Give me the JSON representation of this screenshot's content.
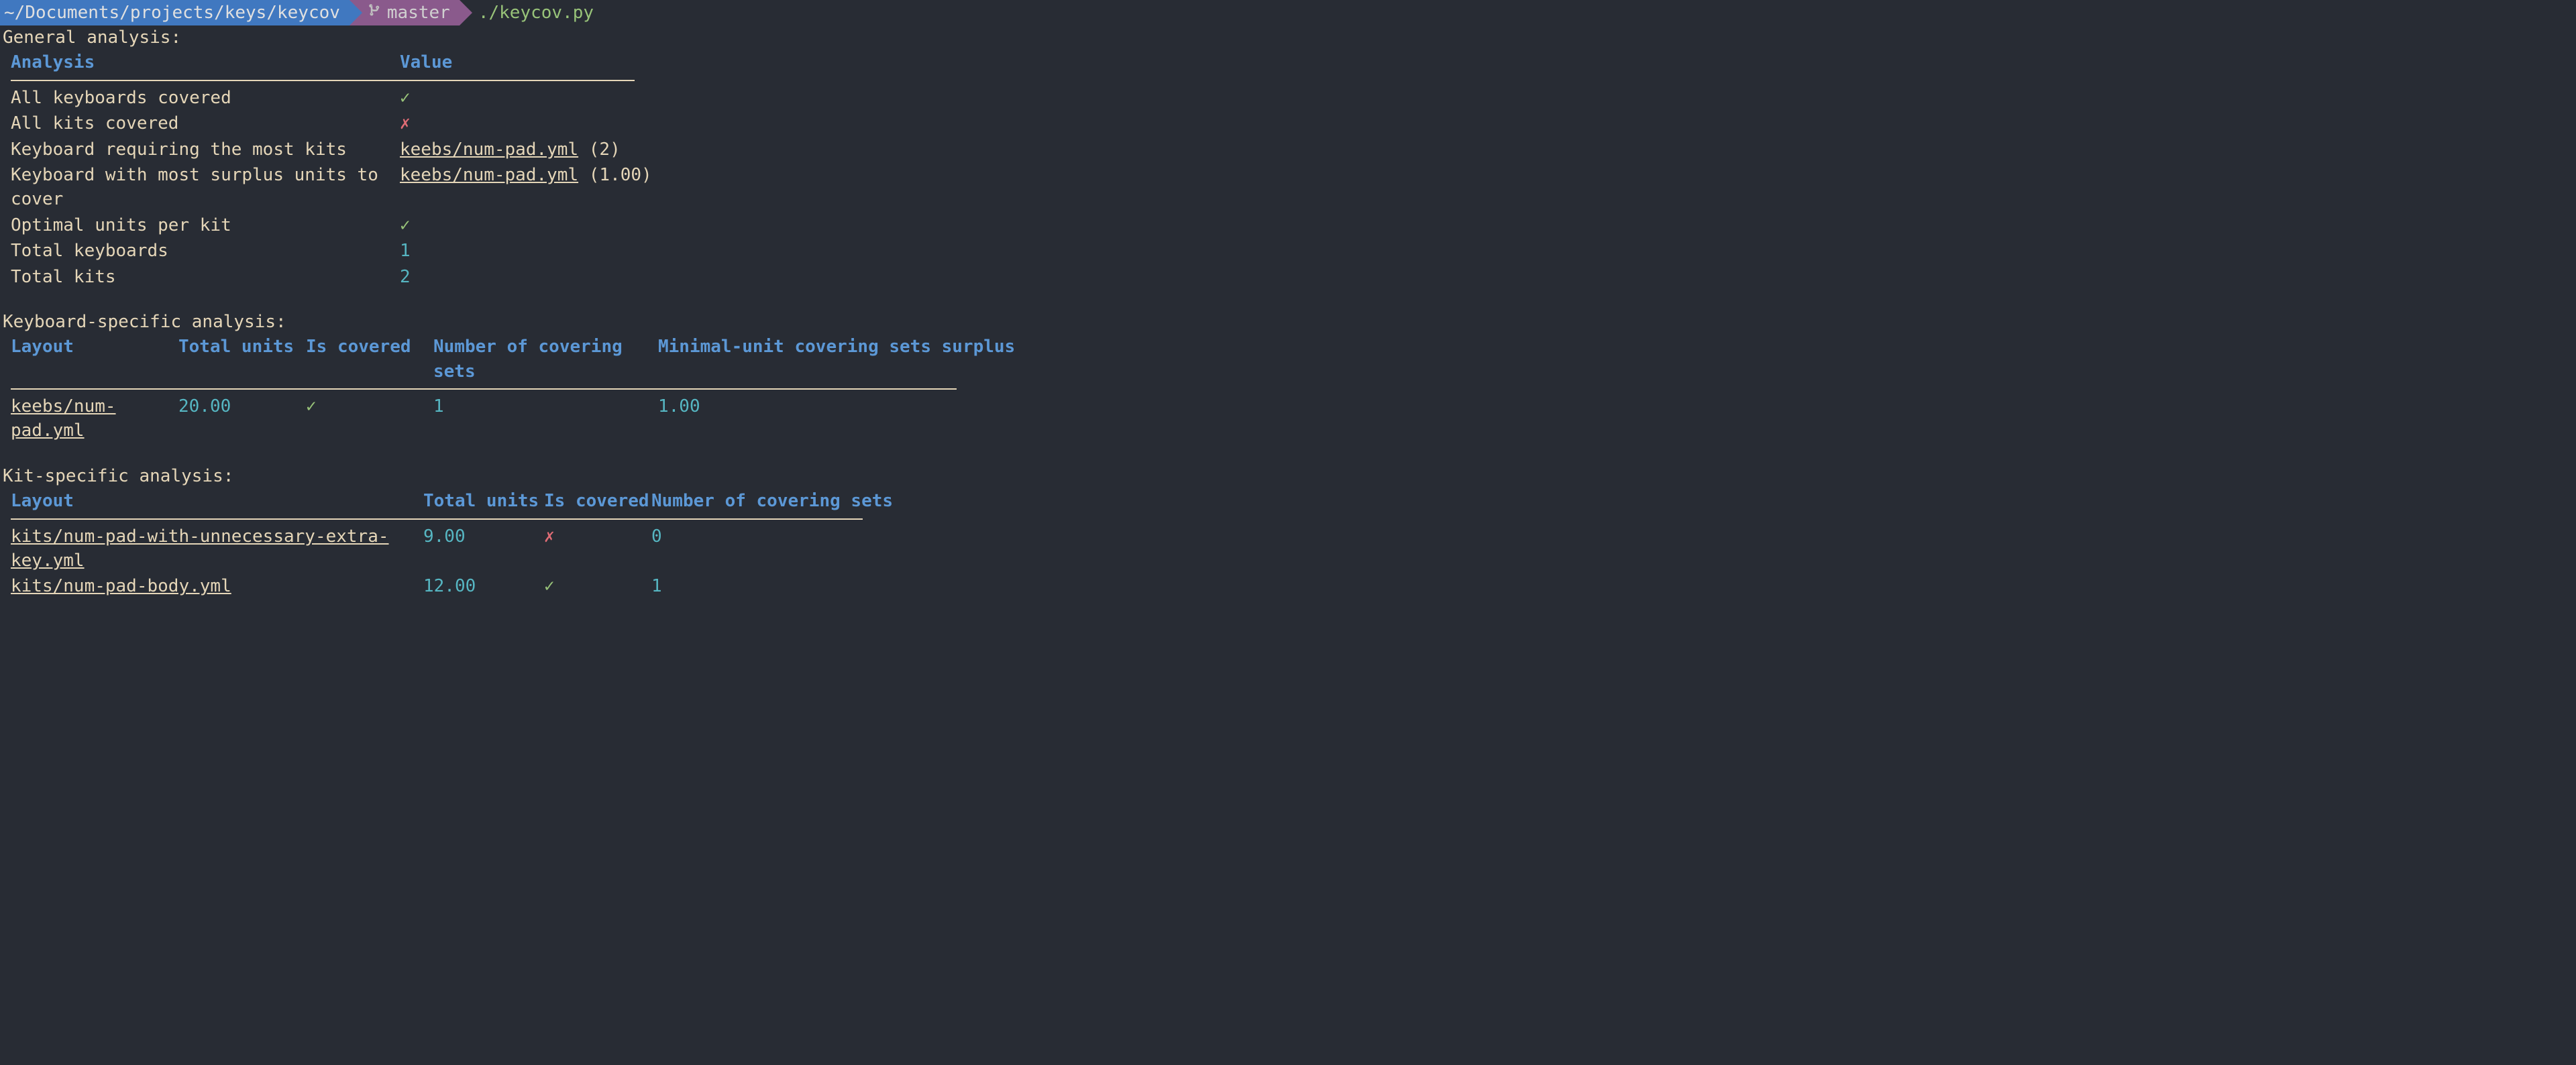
{
  "prompt": {
    "path": "~/Documents/projects/keys/keycov",
    "branch": "master",
    "command": "./keycov.py"
  },
  "general": {
    "title": "General analysis:",
    "header_analysis": "Analysis",
    "header_value": "Value",
    "rows": [
      {
        "label": "All keyboards covered",
        "value": "✓",
        "class": "value-green"
      },
      {
        "label": "All kits covered",
        "value": "✗",
        "class": "value-red"
      },
      {
        "label": "Keyboard requiring the most kits",
        "link": "keebs/num-pad.yml",
        "suffix": " (2)"
      },
      {
        "label": "Keyboard with most surplus units to cover",
        "link": "keebs/num-pad.yml",
        "suffix": " (1.00)"
      },
      {
        "label": "Optimal units per kit",
        "value": "✓",
        "class": "value-green"
      },
      {
        "label": "Total keyboards",
        "value": "1",
        "class": "value-teal"
      },
      {
        "label": "Total kits",
        "value": "2",
        "class": "value-teal"
      }
    ]
  },
  "keyboard": {
    "title": "Keyboard-specific analysis:",
    "headers": {
      "layout": "Layout",
      "total_units": "Total units",
      "is_covered": "Is covered",
      "num_covering": "Number of covering sets",
      "surplus": "Minimal-unit covering sets surplus"
    },
    "rows": [
      {
        "layout": "keebs/num-pad.yml",
        "total_units": "20.00",
        "is_covered": "✓",
        "is_covered_class": "value-green",
        "num_covering": "1",
        "surplus": "1.00"
      }
    ]
  },
  "kit": {
    "title": "Kit-specific analysis:",
    "headers": {
      "layout": "Layout",
      "total_units": "Total units",
      "is_covered": "Is covered",
      "num_covering": "Number of covering sets"
    },
    "rows": [
      {
        "layout": "kits/num-pad-with-unnecessary-extra-key.yml",
        "total_units": "9.00",
        "is_covered": "✗",
        "is_covered_class": "value-red",
        "num_covering": "0"
      },
      {
        "layout": "kits/num-pad-body.yml",
        "total_units": "12.00",
        "is_covered": "✓",
        "is_covered_class": "value-green",
        "num_covering": "1"
      }
    ]
  }
}
